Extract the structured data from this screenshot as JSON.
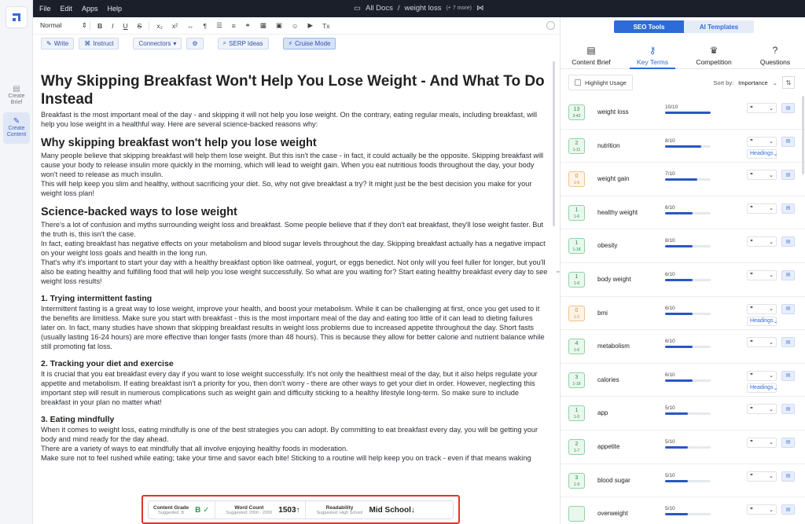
{
  "menubar": {
    "items": [
      "File",
      "Edit",
      "Apps",
      "Help"
    ],
    "breadcrumb": {
      "root": "All Docs",
      "separator": "/",
      "doc": "weight loss",
      "more": "(+ 7 more)"
    }
  },
  "rail": {
    "items": [
      {
        "label": "Create Brief",
        "icon": "file-icon"
      },
      {
        "label": "Create Content",
        "icon": "edit-icon"
      }
    ]
  },
  "toolbar": {
    "style": "Normal",
    "buttons": [
      "B",
      "I",
      "U",
      "S",
      "x₂",
      "x²",
      "¶",
      "Tx"
    ],
    "actions": {
      "write": "Write",
      "instruct": "Instruct",
      "connectors": "Connectors",
      "serp": "SERP Ideas",
      "cruise": "Cruise Mode"
    }
  },
  "doc": {
    "title": "Why Skipping Breakfast Won't Help You Lose Weight - And What To Do Instead",
    "intro": "Breakfast is the most important meal of the day - and skipping it will not help you lose weight. On the contrary, eating regular meals, including breakfast, will help you lose weight in a healthful way. Here are several science-backed reasons why:",
    "h2a": "Why skipping breakfast won't help you lose weight",
    "p1": "Many people believe that skipping breakfast will help them lose weight. But this isn't the case - in fact, it could actually be the opposite. Skipping breakfast will cause your body to release insulin more quickly in the morning, which will lead to weight gain. When you eat nutritious foods throughout the day, your body won't need to release as much insulin.",
    "p2": "This will help keep you slim and healthy, without sacrificing your diet. So, why not give breakfast a try? It might just be the best decision you make for your weight loss plan!",
    "h2b": "Science-backed ways to lose weight",
    "p3": "There's a lot of confusion and myths surrounding weight loss and breakfast. Some people believe that if they don't eat breakfast, they'll lose weight faster. But the truth is, this isn't the case.",
    "p4": "In fact, eating breakfast has negative effects on your metabolism and blood sugar levels throughout the day. Skipping breakfast actually has a negative impact on your weight loss goals and health in the long run.",
    "p5": "That's why it's important to start your day with a healthy breakfast option like oatmeal, yogurt, or eggs benedict. Not only will you feel fuller for longer, but you'll also be eating healthy and fulfilling food that will help you lose weight successfully. So what are you waiting for? Start eating healthy breakfast every day to see weight loss results!",
    "h3a": "1. Trying intermittent fasting",
    "p6": "Intermittent fasting is a great way to lose weight, improve your health, and boost your metabolism. While it can be challenging at first, once you get used to it the benefits are limitless. Make sure you start with breakfast - this is the most important meal of the day and eating too little of it can lead to dieting failures later on. In fact, many studies have shown that skipping breakfast results in weight loss problems due to increased appetite throughout the day. Short fasts (usually lasting 16-24 hours) are more effective than longer fasts (more than 48 hours). This is because they allow for better calorie and nutrient balance while still promoting fat loss.",
    "h3b": "2. Tracking your diet and exercise",
    "p7": "It is crucial that you eat breakfast every day if you want to lose weight successfully. It's not only the healthiest meal of the day, but it also helps regulate your appetite and metabolism. If eating breakfast isn't a priority for you, then don't worry - there are other ways to get your diet in order. However, neglecting this important step will result in numerous complications such as weight gain and difficulty sticking to a healthy lifestyle long-term. So make sure to include breakfast in your plan no matter what!",
    "h3c": "3. Eating mindfully",
    "p8": "When it comes to weight loss, eating mindfully is one of the best strategies you can adopt. By committing to eat breakfast every day, you will be getting your body and mind ready for the day ahead.",
    "p9": "There are a variety of ways to eat mindfully that all involve enjoying healthy foods in moderation.",
    "p10": "Make sure not to feel rushed while eating; take your time and savor each bite! Sticking to a routine will help keep you on track - even if that means waking"
  },
  "stats": {
    "grade": {
      "label": "Content Grade",
      "sub": "Suggested: B",
      "value": "B ✓"
    },
    "words": {
      "label": "Word Count",
      "sub": "Suggested: 2000 - 2200",
      "value": "1503↑"
    },
    "readability": {
      "label": "Readability",
      "sub": "Suggested: High School",
      "value": "Mid School↓"
    }
  },
  "panel": {
    "segments": [
      "SEO Tools",
      "AI Templates"
    ],
    "tabs": [
      {
        "label": "Content Brief",
        "icon": "document-icon"
      },
      {
        "label": "Key Terms",
        "icon": "key-icon"
      },
      {
        "label": "Competition",
        "icon": "trophy-icon"
      },
      {
        "label": "Questions",
        "icon": "question-icon"
      }
    ],
    "highlight": "Highlight Usage",
    "sort_label": "Sort by:",
    "sort_value": "Importance",
    "terms": [
      {
        "badge": "13",
        "range": "3-42",
        "name": "weight loss",
        "score": "10/10",
        "fill": 1.0,
        "warn": false,
        "headings": ""
      },
      {
        "badge": "2",
        "range": "1-11",
        "name": "nutrition",
        "score": "8/10",
        "fill": 0.8,
        "warn": false,
        "headings": "Headings"
      },
      {
        "badge": "0",
        "range": "1-5",
        "name": "weight gain",
        "score": "7/10",
        "fill": 0.7,
        "warn": true,
        "headings": ""
      },
      {
        "badge": "1",
        "range": "1-6",
        "name": "healthy weight",
        "score": "6/10",
        "fill": 0.6,
        "warn": false,
        "headings": ""
      },
      {
        "badge": "1",
        "range": "1-18",
        "name": "obesity",
        "score": "8/10",
        "fill": 0.6,
        "warn": false,
        "headings": ""
      },
      {
        "badge": "1",
        "range": "1-6",
        "name": "body weight",
        "score": "6/10",
        "fill": 0.6,
        "warn": false,
        "headings": ""
      },
      {
        "badge": "0",
        "range": "1-2",
        "name": "bmi",
        "score": "6/10",
        "fill": 0.6,
        "warn": true,
        "headings": "Headings"
      },
      {
        "badge": "4",
        "range": "1-6",
        "name": "metabolism",
        "score": "6/10",
        "fill": 0.6,
        "warn": false,
        "headings": ""
      },
      {
        "badge": "3",
        "range": "1-18",
        "name": "calories",
        "score": "6/10",
        "fill": 0.6,
        "warn": false,
        "headings": "Headings"
      },
      {
        "badge": "1",
        "range": "1-5",
        "name": "app",
        "score": "5/10",
        "fill": 0.5,
        "warn": false,
        "headings": ""
      },
      {
        "badge": "2",
        "range": "1-7",
        "name": "appetite",
        "score": "5/10",
        "fill": 0.5,
        "warn": false,
        "headings": ""
      },
      {
        "badge": "3",
        "range": "1-9",
        "name": "blood sugar",
        "score": "5/10",
        "fill": 0.5,
        "warn": false,
        "headings": ""
      },
      {
        "badge": "",
        "range": "",
        "name": "overweight",
        "score": "5/10",
        "fill": 0.5,
        "warn": false,
        "headings": ""
      }
    ]
  },
  "colors": {
    "accent": "#2f6bd6",
    "bar": "#2a56c6",
    "grade": "#2e9a56",
    "highlight_border": "#e2322a"
  }
}
